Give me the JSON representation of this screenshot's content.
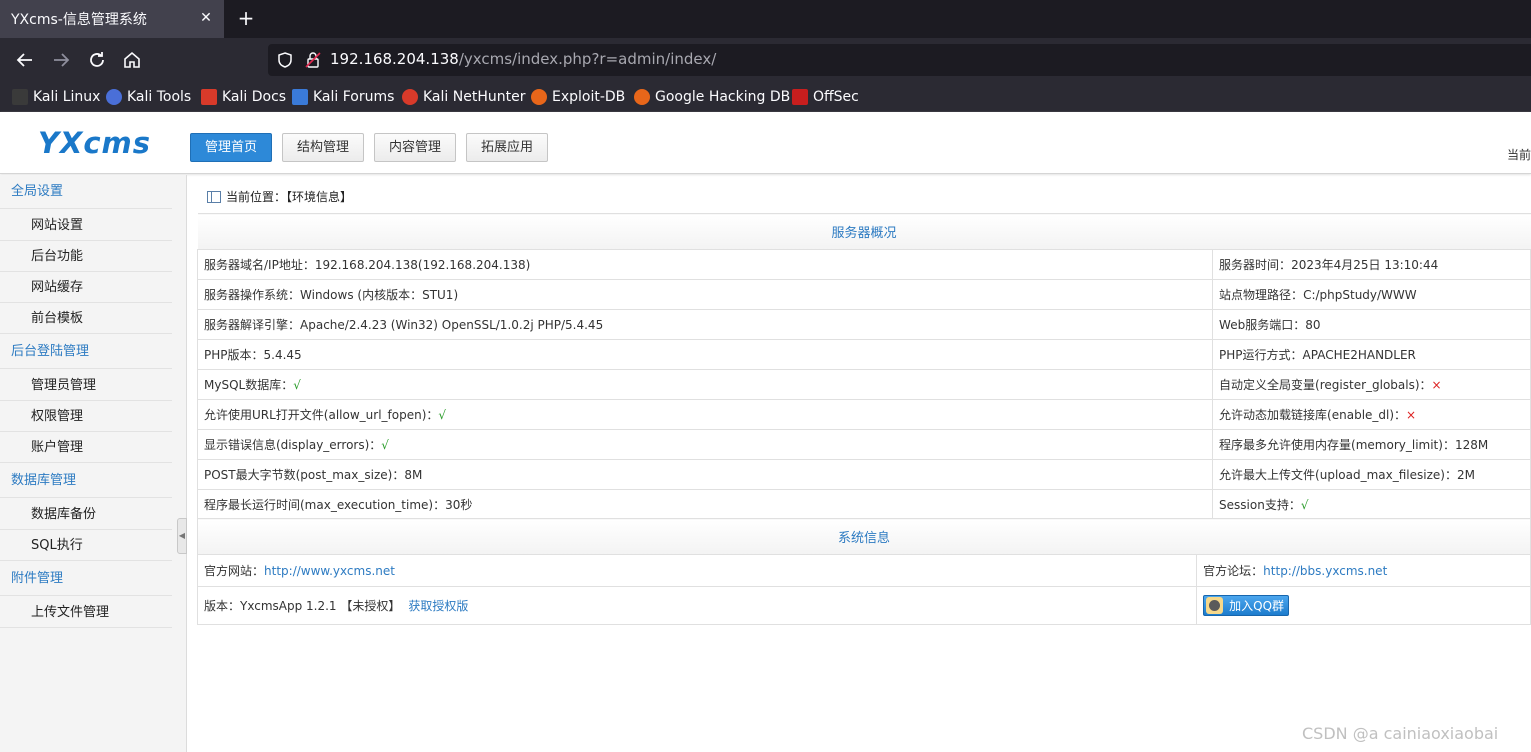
{
  "browser": {
    "tab_title": "YXcms-信息管理系统",
    "tab_close": "✕",
    "new_tab": "+",
    "url_host": "192.168.204.138",
    "url_path": "/yxcms/index.php?r=admin/index/",
    "bookmarks": [
      {
        "label": "Kali Linux",
        "icon": "kali-linux-icon",
        "color": "#3a3a3a"
      },
      {
        "label": "Kali Tools",
        "icon": "kali-tools-icon",
        "color": "#4a6fd8"
      },
      {
        "label": "Kali Docs",
        "icon": "kali-docs-icon",
        "color": "#d83a2a"
      },
      {
        "label": "Kali Forums",
        "icon": "kali-forums-icon",
        "color": "#3a7ad8"
      },
      {
        "label": "Kali NetHunter",
        "icon": "kali-nethunter-icon",
        "color": "#d83a2a"
      },
      {
        "label": "Exploit-DB",
        "icon": "exploit-db-icon",
        "color": "#e8661a"
      },
      {
        "label": "Google Hacking DB",
        "icon": "google-hacking-db-icon",
        "color": "#e8661a"
      },
      {
        "label": "OffSec",
        "icon": "offsec-icon",
        "color": "#c81e1e"
      }
    ]
  },
  "cms": {
    "logo": "YXcms",
    "top_nav": [
      {
        "label": "管理首页",
        "active": true
      },
      {
        "label": "结构管理",
        "active": false
      },
      {
        "label": "内容管理",
        "active": false
      },
      {
        "label": "拓展应用",
        "active": false
      }
    ],
    "current_right": "当前",
    "sidebar": [
      {
        "group": "全局设置",
        "items": [
          "网站设置",
          "后台功能",
          "网站缓存",
          "前台模板"
        ]
      },
      {
        "group": "后台登陆管理",
        "items": [
          "管理员管理",
          "权限管理",
          "账户管理"
        ]
      },
      {
        "group": "数据库管理",
        "items": [
          "数据库备份",
          "SQL执行"
        ]
      },
      {
        "group": "附件管理",
        "items": [
          "上传文件管理"
        ]
      }
    ],
    "breadcrumb": "当前位置：【环境信息】",
    "server_section_title": "服务器概况",
    "server_rows": [
      {
        "left_label": "服务器域名/IP地址：",
        "left_value": "192.168.204.138(192.168.204.138)",
        "left_status": "",
        "right_label": "服务器时间：",
        "right_value": "2023年4月25日 13:10:44",
        "right_status": ""
      },
      {
        "left_label": "服务器操作系统：",
        "left_value": "Windows (内核版本：STU1)",
        "left_status": "",
        "right_label": "站点物理路径：",
        "right_value": "C:/phpStudy/WWW",
        "right_status": ""
      },
      {
        "left_label": "服务器解译引擎：",
        "left_value": "Apache/2.4.23 (Win32) OpenSSL/1.0.2j PHP/5.4.45",
        "left_status": "",
        "right_label": "Web服务端口：",
        "right_value": "80",
        "right_status": ""
      },
      {
        "left_label": "PHP版本：",
        "left_value": "5.4.45",
        "left_status": "",
        "right_label": "PHP运行方式：",
        "right_value": "APACHE2HANDLER",
        "right_status": ""
      },
      {
        "left_label": "MySQL数据库：",
        "left_value": "",
        "left_status": "√",
        "right_label": "自动定义全局变量(register_globals)：",
        "right_value": "",
        "right_status": "×"
      },
      {
        "left_label": "允许使用URL打开文件(allow_url_fopen)：",
        "left_value": "",
        "left_status": "√",
        "right_label": "允许动态加载链接库(enable_dl)：",
        "right_value": "",
        "right_status": "×"
      },
      {
        "left_label": "显示错误信息(display_errors)：",
        "left_value": "",
        "left_status": "√",
        "right_label": "程序最多允许使用内存量(memory_limit)：",
        "right_value": "128M",
        "right_status": ""
      },
      {
        "left_label": "POST最大字节数(post_max_size)：",
        "left_value": "8M",
        "left_status": "",
        "right_label": "允许最大上传文件(upload_max_filesize)：",
        "right_value": "2M",
        "right_status": ""
      },
      {
        "left_label": "程序最长运行时间(max_execution_time)：",
        "left_value": "30秒",
        "left_status": "",
        "right_label": "Session支持：",
        "right_value": "",
        "right_status": "√"
      }
    ],
    "system_section_title": "系统信息",
    "official_site_label": "官方网站：",
    "official_site_url": "http://www.yxcms.net",
    "official_forum_label": "官方论坛：",
    "official_forum_url": "http://bbs.yxcms.net",
    "version_label": "版本：",
    "version_value": "YxcmsApp 1.2.1 【未授权】",
    "get_license": "获取授权版",
    "qq_group_button": "加入QQ群"
  },
  "watermark": "CSDN @a cainiaoxiaobai"
}
